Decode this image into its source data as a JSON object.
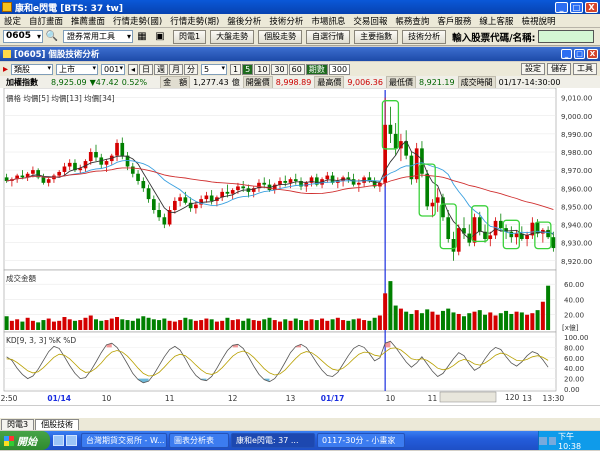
{
  "window": {
    "title": "康和e閃電 [BTS: 37 tw]",
    "buttons": [
      "_",
      "□",
      "X"
    ]
  },
  "menu": [
    "設定",
    "自訂畫面",
    "推薦畫面",
    "行情走勢(國)",
    "行情走勢(期)",
    "盤後分析",
    "技術分析",
    "市場訊息",
    "交易回報",
    "帳務查詢",
    "客戶服務",
    "線上客服",
    "檢視說明"
  ],
  "toolbar": {
    "code": "0605",
    "tools_select": "證券常用工具",
    "buttons": [
      "閃電1",
      "大盤走勢",
      "個股走勢",
      "自選行情",
      "主要指數",
      "技術分析"
    ],
    "search_label": "輸入股票代碼/名稱:",
    "search_value": ""
  },
  "doc": {
    "title": "[0605] 個股技術分析"
  },
  "controls": {
    "type": "類股",
    "market": "上市",
    "code": "001",
    "periods": [
      "日",
      "週",
      "月",
      "分"
    ],
    "minute_value": "5",
    "minute_options": [
      "1",
      "5",
      "10",
      "30",
      "60",
      "期數"
    ],
    "count": "300",
    "right_buttons": [
      "設定",
      "儲存",
      "工具"
    ]
  },
  "info": {
    "name": "加權指數",
    "time_label": "8,925.09",
    "change": "▼47.42",
    "pct": "0.52%",
    "amount_label": "金　額",
    "amount_value": "1,277.43",
    "amount_unit": "億",
    "open_label": "開盤價",
    "open_value": "8,998.89",
    "high_label": "最高價",
    "high_value": "9,006.36",
    "low_label": "最低價",
    "low_value": "8,921.19",
    "dt_label": "成交時間",
    "dt_value": "01/17-14:30:00"
  },
  "chart_data": {
    "type": "candlestick",
    "price_legend": "價格 均價[5] 均價[13] 均價[34]",
    "price_ticks": [
      "9,010.00",
      "9,000.00",
      "8,990.00",
      "8,980.00",
      "8,970.00",
      "8,960.00",
      "8,950.00",
      "8,940.00",
      "8,930.00",
      "8,920.00"
    ],
    "ylim": [
      8916,
      9012
    ],
    "ohlc": [
      [
        8966,
        8968,
        8963,
        8964
      ],
      [
        8964,
        8966,
        8961,
        8965
      ],
      [
        8965,
        8968,
        8963,
        8967
      ],
      [
        8967,
        8970,
        8965,
        8966
      ],
      [
        8966,
        8969,
        8964,
        8968
      ],
      [
        8968,
        8972,
        8966,
        8970
      ],
      [
        8970,
        8971,
        8965,
        8966
      ],
      [
        8966,
        8968,
        8962,
        8963
      ],
      [
        8963,
        8966,
        8961,
        8965
      ],
      [
        8965,
        8968,
        8963,
        8967
      ],
      [
        8967,
        8970,
        8966,
        8969
      ],
      [
        8969,
        8974,
        8967,
        8972
      ],
      [
        8972,
        8976,
        8970,
        8974
      ],
      [
        8974,
        8976,
        8969,
        8970
      ],
      [
        8970,
        8973,
        8968,
        8971
      ],
      [
        8971,
        8976,
        8969,
        8975
      ],
      [
        8975,
        8982,
        8973,
        8980
      ],
      [
        8980,
        8984,
        8975,
        8977
      ],
      [
        8977,
        8979,
        8971,
        8973
      ],
      [
        8973,
        8976,
        8969,
        8975
      ],
      [
        8975,
        8979,
        8973,
        8978
      ],
      [
        8978,
        8987,
        8975,
        8985
      ],
      [
        8985,
        8988,
        8976,
        8978
      ],
      [
        8978,
        8980,
        8970,
        8972
      ],
      [
        8972,
        8974,
        8966,
        8968
      ],
      [
        8968,
        8970,
        8962,
        8964
      ],
      [
        8964,
        8966,
        8958,
        8960
      ],
      [
        8960,
        8962,
        8952,
        8954
      ],
      [
        8954,
        8956,
        8946,
        8948
      ],
      [
        8948,
        8952,
        8942,
        8944
      ],
      [
        8944,
        8946,
        8938,
        8940
      ],
      [
        8940,
        8950,
        8939,
        8948
      ],
      [
        8948,
        8955,
        8946,
        8953
      ],
      [
        8953,
        8957,
        8950,
        8955
      ],
      [
        8955,
        8958,
        8951,
        8952
      ],
      [
        8952,
        8955,
        8947,
        8949
      ],
      [
        8949,
        8953,
        8946,
        8951
      ],
      [
        8951,
        8956,
        8949,
        8954
      ],
      [
        8954,
        8958,
        8952,
        8956
      ],
      [
        8956,
        8959,
        8951,
        8953
      ],
      [
        8953,
        8956,
        8950,
        8955
      ],
      [
        8955,
        8960,
        8953,
        8958
      ],
      [
        8958,
        8962,
        8955,
        8957
      ],
      [
        8957,
        8960,
        8954,
        8959
      ],
      [
        8959,
        8963,
        8957,
        8961
      ],
      [
        8961,
        8964,
        8958,
        8960
      ],
      [
        8960,
        8962,
        8955,
        8958
      ],
      [
        8958,
        8961,
        8955,
        8960
      ],
      [
        8960,
        8965,
        8958,
        8963
      ],
      [
        8963,
        8966,
        8960,
        8962
      ],
      [
        8962,
        8965,
        8958,
        8959
      ],
      [
        8959,
        8963,
        8957,
        8962
      ],
      [
        8962,
        8966,
        8960,
        8964
      ],
      [
        8964,
        8967,
        8961,
        8963
      ],
      [
        8963,
        8966,
        8960,
        8965
      ],
      [
        8965,
        8968,
        8962,
        8964
      ],
      [
        8964,
        8966,
        8959,
        8961
      ],
      [
        8961,
        8964,
        8958,
        8963
      ],
      [
        8963,
        8967,
        8961,
        8966
      ],
      [
        8966,
        8968,
        8961,
        8962
      ],
      [
        8962,
        8966,
        8960,
        8965
      ],
      [
        8965,
        8969,
        8963,
        8967
      ],
      [
        8967,
        8969,
        8962,
        8963
      ],
      [
        8963,
        8966,
        8960,
        8964
      ],
      [
        8964,
        8967,
        8961,
        8966
      ],
      [
        8966,
        8969,
        8963,
        8965
      ],
      [
        8965,
        8968,
        8961,
        8962
      ],
      [
        8962,
        8965,
        8958,
        8963
      ],
      [
        8963,
        8967,
        8961,
        8966
      ],
      [
        8966,
        8969,
        8963,
        8964
      ],
      [
        8964,
        8966,
        8960,
        8961
      ],
      [
        8961,
        8964,
        8958,
        8963
      ],
      [
        8963,
        9010,
        8961,
        8995
      ],
      [
        8995,
        9005,
        8985,
        8990
      ],
      [
        8990,
        8996,
        8978,
        8982
      ],
      [
        8982,
        8990,
        8975,
        8986
      ],
      [
        8986,
        8992,
        8976,
        8978
      ],
      [
        8978,
        8980,
        8962,
        8965
      ],
      [
        8965,
        8985,
        8963,
        8982
      ],
      [
        8982,
        8986,
        8966,
        8968
      ],
      [
        8968,
        8970,
        8948,
        8950
      ],
      [
        8950,
        8954,
        8944,
        8952
      ],
      [
        8952,
        8960,
        8947,
        8955
      ],
      [
        8955,
        8957,
        8942,
        8944
      ],
      [
        8944,
        8948,
        8930,
        8932
      ],
      [
        8932,
        8936,
        8920,
        8925
      ],
      [
        8925,
        8940,
        8923,
        8938
      ],
      [
        8938,
        8944,
        8932,
        8935
      ],
      [
        8935,
        8940,
        8928,
        8930
      ],
      [
        8930,
        8946,
        8928,
        8944
      ],
      [
        8944,
        8947,
        8934,
        8936
      ],
      [
        8936,
        8940,
        8930,
        8932
      ],
      [
        8932,
        8936,
        8928,
        8934
      ],
      [
        8934,
        8944,
        8932,
        8942
      ],
      [
        8942,
        8946,
        8936,
        8938
      ],
      [
        8938,
        8940,
        8932,
        8936
      ],
      [
        8936,
        8939,
        8930,
        8933
      ],
      [
        8933,
        8937,
        8929,
        8935
      ],
      [
        8935,
        8939,
        8931,
        8932
      ],
      [
        8932,
        8936,
        8928,
        8934
      ],
      [
        8934,
        8944,
        8932,
        8941
      ],
      [
        8941,
        8943,
        8933,
        8935
      ],
      [
        8935,
        8938,
        8930,
        8937
      ],
      [
        8937,
        8939,
        8932,
        8933
      ],
      [
        8933,
        8936,
        8925,
        8927
      ]
    ],
    "volume_legend": "成交金額",
    "volume_ticks": [
      "60.00",
      "40.00",
      "20.00"
    ],
    "volume_unit": "[x億]",
    "volume_ylim": [
      0,
      72
    ],
    "volume": [
      18,
      12,
      14,
      11,
      16,
      12,
      10,
      13,
      15,
      11,
      12,
      17,
      14,
      12,
      13,
      16,
      19,
      14,
      12,
      13,
      15,
      17,
      14,
      13,
      12,
      15,
      18,
      16,
      14,
      13,
      15,
      12,
      11,
      13,
      16,
      14,
      12,
      13,
      15,
      14,
      11,
      12,
      16,
      13,
      14,
      12,
      15,
      13,
      12,
      14,
      16,
      13,
      11,
      14,
      12,
      15,
      13,
      12,
      14,
      13,
      15,
      12,
      14,
      16,
      13,
      12,
      14,
      15,
      13,
      12,
      16,
      19,
      48,
      64,
      32,
      28,
      24,
      21,
      26,
      22,
      27,
      24,
      20,
      25,
      28,
      23,
      21,
      18,
      22,
      24,
      26,
      20,
      23,
      19,
      22,
      25,
      21,
      24,
      23,
      20,
      22,
      26,
      37,
      58
    ],
    "kd_legend": "KD[9, 3, 3]  %K  %D",
    "kd_ticks": [
      "100.00",
      "80.00",
      "60.00",
      "40.00",
      "20.00",
      "0.00"
    ],
    "kd_ylim": [
      0,
      100
    ],
    "k": [
      62,
      55,
      40,
      28,
      20,
      25,
      38,
      55,
      72,
      82,
      78,
      62,
      45,
      30,
      20,
      22,
      35,
      52,
      70,
      85,
      88,
      80,
      65,
      48,
      30,
      18,
      12,
      15,
      28,
      45,
      62,
      76,
      82,
      75,
      58,
      40,
      26,
      18,
      16,
      24,
      40,
      58,
      74,
      84,
      86,
      78,
      62,
      44,
      28,
      18,
      14,
      20,
      34,
      52,
      70,
      82,
      86,
      80,
      66,
      50,
      36,
      26,
      24,
      32,
      48,
      64,
      78,
      84,
      80,
      68,
      54,
      60,
      88,
      92,
      80,
      66,
      52,
      42,
      50,
      62,
      48,
      34,
      24,
      30,
      44,
      58,
      70,
      64,
      48,
      36,
      42,
      58,
      72,
      80,
      76,
      62,
      50,
      44,
      52,
      64,
      72,
      68,
      56,
      42
    ],
    "d": [
      58,
      57,
      51,
      43,
      35,
      31,
      33,
      41,
      51,
      61,
      67,
      65,
      58,
      48,
      38,
      32,
      33,
      40,
      50,
      62,
      71,
      74,
      71,
      63,
      52,
      40,
      30,
      25,
      26,
      32,
      42,
      53,
      63,
      67,
      64,
      56,
      46,
      37,
      30,
      28,
      32,
      41,
      52,
      63,
      70,
      73,
      69,
      61,
      50,
      39,
      31,
      27,
      29,
      37,
      48,
      59,
      68,
      72,
      70,
      63,
      54,
      45,
      38,
      36,
      40,
      48,
      58,
      67,
      71,
      70,
      65,
      63,
      71,
      78,
      79,
      75,
      67,
      58,
      56,
      58,
      55,
      48,
      40,
      37,
      39,
      45,
      53,
      57,
      54,
      48,
      46,
      50,
      57,
      65,
      69,
      67,
      61,
      55,
      54,
      57,
      62,
      64,
      61,
      55
    ],
    "x_labels": [
      "12:50",
      "01/14",
      "10",
      "11",
      "12",
      "13",
      "01/17",
      "10",
      "11",
      "12",
      "13",
      "13:30"
    ],
    "zoom": "120"
  },
  "tabs": [
    "閃電3",
    "個股技術"
  ],
  "taskbar": {
    "start": "開始",
    "tasks": [
      "台灣期貨交易所 - W...",
      "圖表分析表",
      "康和e閃電: 37 ...",
      "0117-30分 - 小畫家"
    ],
    "clock": "下午 10:38"
  }
}
